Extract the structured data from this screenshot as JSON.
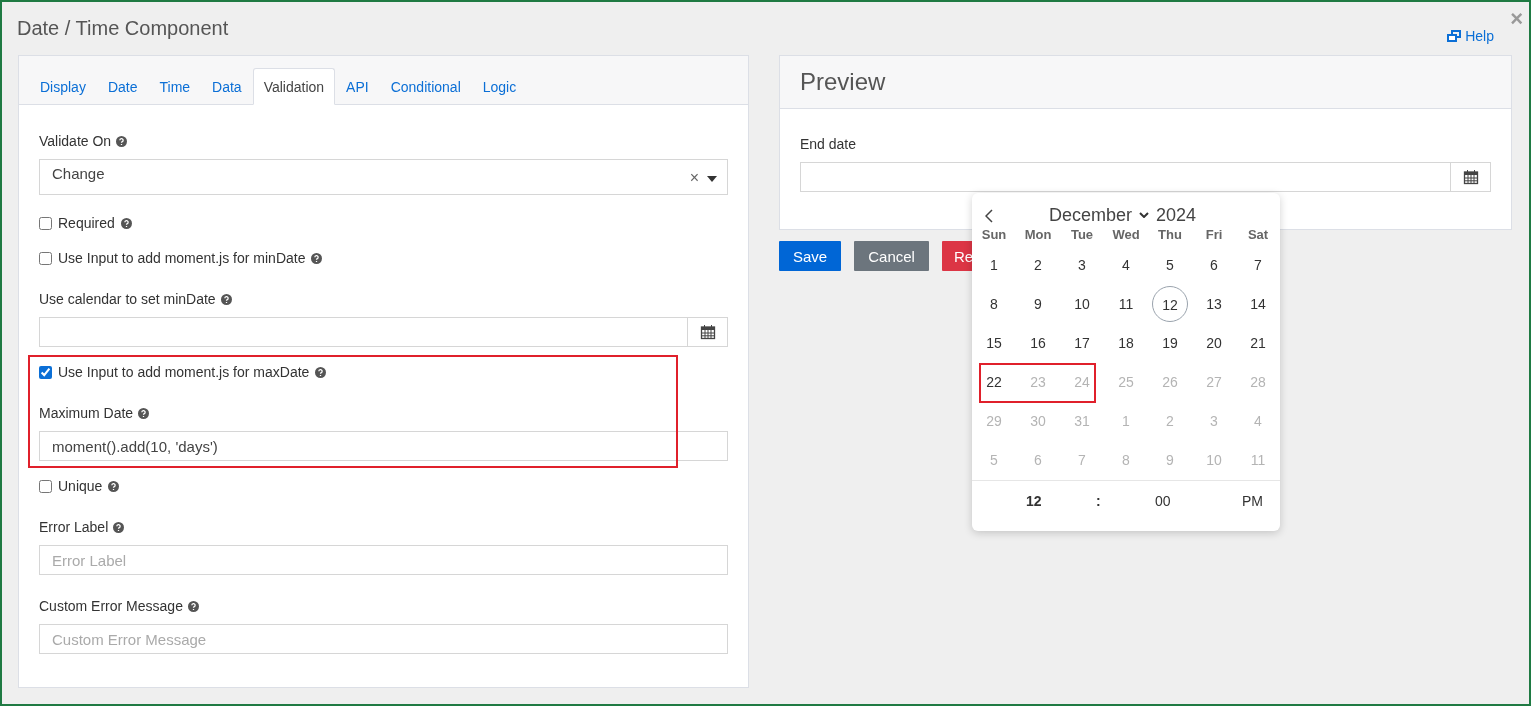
{
  "window": {
    "title": "Date / Time Component",
    "close_symbol": "×"
  },
  "help_link": {
    "label": "Help"
  },
  "tabs": [
    {
      "label": "Display",
      "selected": false
    },
    {
      "label": "Date",
      "selected": false
    },
    {
      "label": "Time",
      "selected": false
    },
    {
      "label": "Data",
      "selected": false
    },
    {
      "label": "Validation",
      "selected": true
    },
    {
      "label": "API",
      "selected": false
    },
    {
      "label": "Conditional",
      "selected": false
    },
    {
      "label": "Logic",
      "selected": false
    }
  ],
  "sections": [
    {
      "highlighted": false,
      "fields": [
        {
          "kind": "select",
          "label": "Validate On",
          "value": "Change",
          "clear_symbol": "×"
        },
        {
          "kind": "checkbox",
          "label": "Required",
          "checked": false
        },
        {
          "kind": "checkbox",
          "label": "Use Input to add moment.js for minDate",
          "checked": false
        },
        {
          "kind": "date",
          "label": "Use calendar to set minDate"
        }
      ]
    },
    {
      "highlighted": true,
      "fields": [
        {
          "kind": "checkbox",
          "label": "Use Input to add moment.js for maxDate",
          "checked": true
        },
        {
          "kind": "text",
          "label": "Maximum Date",
          "value": "moment().add(10, 'days')"
        }
      ]
    },
    {
      "highlighted": false,
      "fields": [
        {
          "kind": "checkbox",
          "label": "Unique",
          "checked": false
        },
        {
          "kind": "text",
          "label": "Error Label",
          "placeholder": "Error Label"
        },
        {
          "kind": "text",
          "label": "Custom Error Message",
          "placeholder": "Custom Error Message"
        }
      ]
    }
  ],
  "preview": {
    "title": "Preview",
    "field_label": "End date",
    "buttons": [
      {
        "kind": "primary",
        "label": "Save"
      },
      {
        "kind": "secondary",
        "label": "Cancel"
      },
      {
        "kind": "danger",
        "label": "Re"
      }
    ]
  },
  "calendar": {
    "month": "December",
    "year": "2024",
    "weekdays": [
      "Sun",
      "Mon",
      "Tue",
      "Wed",
      "Thu",
      "Fri",
      "Sat"
    ],
    "weeks": [
      [
        {
          "label": "1",
          "disabled": false,
          "today": false,
          "highlighted": false
        },
        {
          "label": "2",
          "disabled": false,
          "today": false,
          "highlighted": false
        },
        {
          "label": "3",
          "disabled": false,
          "today": false,
          "highlighted": false
        },
        {
          "label": "4",
          "disabled": false,
          "today": false,
          "highlighted": false
        },
        {
          "label": "5",
          "disabled": false,
          "today": false,
          "highlighted": false
        },
        {
          "label": "6",
          "disabled": false,
          "today": false,
          "highlighted": false
        },
        {
          "label": "7",
          "disabled": false,
          "today": false,
          "highlighted": false
        }
      ],
      [
        {
          "label": "8",
          "disabled": false,
          "today": false,
          "highlighted": false
        },
        {
          "label": "9",
          "disabled": false,
          "today": false,
          "highlighted": false
        },
        {
          "label": "10",
          "disabled": false,
          "today": false,
          "highlighted": false
        },
        {
          "label": "11",
          "disabled": false,
          "today": false,
          "highlighted": false
        },
        {
          "label": "12",
          "disabled": false,
          "today": true,
          "highlighted": false
        },
        {
          "label": "13",
          "disabled": false,
          "today": false,
          "highlighted": false
        },
        {
          "label": "14",
          "disabled": false,
          "today": false,
          "highlighted": false
        }
      ],
      [
        {
          "label": "15",
          "disabled": false,
          "today": false,
          "highlighted": false
        },
        {
          "label": "16",
          "disabled": false,
          "today": false,
          "highlighted": false
        },
        {
          "label": "17",
          "disabled": false,
          "today": false,
          "highlighted": false
        },
        {
          "label": "18",
          "disabled": false,
          "today": false,
          "highlighted": false
        },
        {
          "label": "19",
          "disabled": false,
          "today": false,
          "highlighted": false
        },
        {
          "label": "20",
          "disabled": false,
          "today": false,
          "highlighted": false
        },
        {
          "label": "21",
          "disabled": false,
          "today": false,
          "highlighted": false
        }
      ],
      [
        {
          "label": "22",
          "disabled": false,
          "today": false,
          "highlighted": true
        },
        {
          "label": "23",
          "disabled": true,
          "today": false,
          "highlighted": true
        },
        {
          "label": "24",
          "disabled": true,
          "today": false,
          "highlighted": true
        },
        {
          "label": "25",
          "disabled": true,
          "today": false,
          "highlighted": false
        },
        {
          "label": "26",
          "disabled": true,
          "today": false,
          "highlighted": false
        },
        {
          "label": "27",
          "disabled": true,
          "today": false,
          "highlighted": false
        },
        {
          "label": "28",
          "disabled": true,
          "today": false,
          "highlighted": false
        }
      ],
      [
        {
          "label": "29",
          "disabled": true,
          "today": false,
          "highlighted": false
        },
        {
          "label": "30",
          "disabled": true,
          "today": false,
          "highlighted": false
        },
        {
          "label": "31",
          "disabled": true,
          "today": false,
          "highlighted": false
        },
        {
          "label": "1",
          "disabled": true,
          "today": false,
          "highlighted": false
        },
        {
          "label": "2",
          "disabled": true,
          "today": false,
          "highlighted": false
        },
        {
          "label": "3",
          "disabled": true,
          "today": false,
          "highlighted": false
        },
        {
          "label": "4",
          "disabled": true,
          "today": false,
          "highlighted": false
        }
      ],
      [
        {
          "label": "5",
          "disabled": true,
          "today": false,
          "highlighted": false
        },
        {
          "label": "6",
          "disabled": true,
          "today": false,
          "highlighted": false
        },
        {
          "label": "7",
          "disabled": true,
          "today": false,
          "highlighted": false
        },
        {
          "label": "8",
          "disabled": true,
          "today": false,
          "highlighted": false
        },
        {
          "label": "9",
          "disabled": true,
          "today": false,
          "highlighted": false
        },
        {
          "label": "10",
          "disabled": true,
          "today": false,
          "highlighted": false
        },
        {
          "label": "11",
          "disabled": true,
          "today": false,
          "highlighted": false
        }
      ]
    ],
    "time": {
      "hour": "12",
      "separator": ":",
      "minute": "00",
      "period": "PM"
    }
  }
}
